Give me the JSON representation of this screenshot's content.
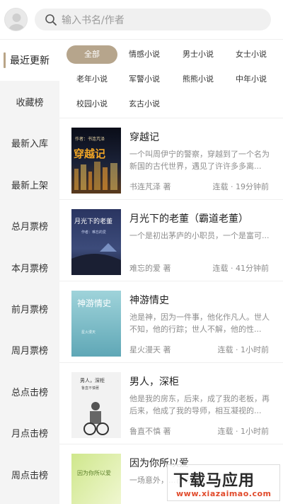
{
  "search": {
    "placeholder": "输入书名/作者"
  },
  "sidebar": {
    "items": [
      {
        "label": "最近更新"
      },
      {
        "label": "收藏榜"
      },
      {
        "label": "最新入库"
      },
      {
        "label": "最新上架"
      },
      {
        "label": "总月票榜"
      },
      {
        "label": "本月票榜"
      },
      {
        "label": "前月票榜"
      },
      {
        "label": "周月票榜"
      },
      {
        "label": "总点击榜"
      },
      {
        "label": "月点击榜"
      },
      {
        "label": "周点击榜"
      }
    ]
  },
  "categories": [
    {
      "label": "全部"
    },
    {
      "label": "情感小说"
    },
    {
      "label": "男士小说"
    },
    {
      "label": "女士小说"
    },
    {
      "label": "老年小说"
    },
    {
      "label": "军警小说"
    },
    {
      "label": "熊熊小说"
    },
    {
      "label": "中年小说"
    },
    {
      "label": "校园小说"
    },
    {
      "label": "玄古小说"
    }
  ],
  "books": [
    {
      "title": "穿越记",
      "desc": "一个叫周伊宁的警察，穿越到了一个名为新国的古代世界，遇见了许许多多离...",
      "author": "书连芃泽 著",
      "status": "连载 · 19分钟前",
      "cover_text": "穿越记",
      "cover_author": "作者：书连芃泽"
    },
    {
      "title": "月光下的老董（霸道老董）",
      "desc": "一个是初出茅庐的小职员，一个是富可...",
      "author": "难忘的爱 著",
      "status": "连载 · 41分钟前",
      "cover_text": "月光下的老董",
      "cover_author": "作者：难忘的爱"
    },
    {
      "title": "神游情史",
      "desc": "池是神，因为一件事，他化作凡人。世人不知，他的行踪；世人不解，他的性...",
      "author": "星火漫天 著",
      "status": "连载 · 1小时前",
      "cover_text": "神游情史",
      "cover_author": "星火漫天"
    },
    {
      "title": "男人，深柜",
      "desc": "他是我的房东，后来，成了我的老板，再后来，他成了我的导师，相互凝视的...",
      "author": "鲁直不慎 著",
      "status": "连载 · 1小时前",
      "cover_text": "男人，深柜",
      "cover_author": "鲁直不慎著"
    },
    {
      "title": "因为你所以爱",
      "desc": "一场意外，...己丢失的东...",
      "author": "",
      "status": "",
      "cover_text": "因为你所以爱",
      "cover_author": ""
    }
  ],
  "watermark": {
    "main": "下载马应用",
    "sub": "www.xiazaimao.com"
  },
  "colors": {
    "accent": "#b6a58c",
    "sidebar_bg": "#f4f4f4"
  }
}
